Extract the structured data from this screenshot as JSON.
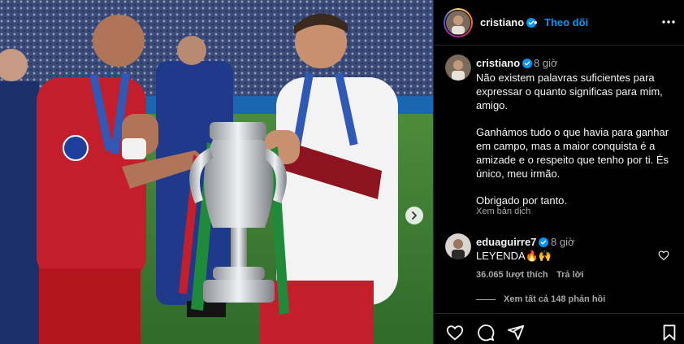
{
  "post": {
    "image_description": "",
    "carousel_next_icon": "chevron-right-icon"
  },
  "header": {
    "username": "cristiano",
    "dot": "•",
    "follow_label": "Theo dõi",
    "more_icon": "more-horizontal-icon"
  },
  "caption": {
    "username": "cristiano",
    "time": "8 giờ",
    "paragraphs": [
      "Não existem palavras suficientes para expressar o quanto significas para mim, amigo.",
      "Ganhámos tudo o que havia para ganhar em campo, mas a maior conquista é a amizade e o respeito que tenho por ti. És único, meu irmão.",
      "Obrigado por tanto."
    ],
    "translate_label": "Xem bản dịch"
  },
  "comment": {
    "username": "eduaguirre7",
    "time": "8 giờ",
    "text": "LEYENDA🔥🙌",
    "likes": "36.065 lượt thích",
    "reply_label": "Trả lời",
    "view_replies": "Xem tất cả 148 phản hồi"
  },
  "actions": {
    "like_icon": "heart-icon",
    "comment_icon": "comment-icon",
    "share_icon": "send-icon",
    "save_icon": "bookmark-icon"
  },
  "colors": {
    "accent": "#0095f6",
    "verified": "#0095f6",
    "background": "#000000",
    "secondary_text": "#a8a8a8"
  }
}
